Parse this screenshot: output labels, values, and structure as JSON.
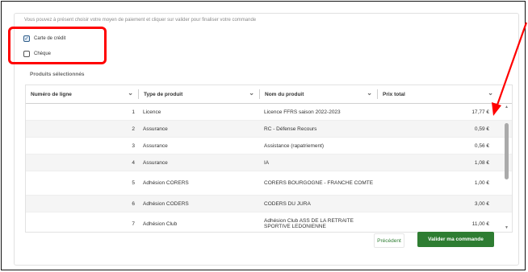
{
  "payment": {
    "instruction": "Vous pouvez à présent choisir votre moyen de paiement et cliquer sur valider pour finaliser votre commande",
    "options": [
      {
        "label": "Carte de crédit",
        "checked": true
      },
      {
        "label": "Chèque",
        "checked": false
      }
    ]
  },
  "products": {
    "title": "Produits sélectionnés",
    "columns": [
      "Numéro de ligne",
      "Type de produit",
      "Nom du produit",
      "Prix total"
    ],
    "rows": [
      {
        "line": "1",
        "type": "Licence",
        "name": "Licence FFRS saison 2022-2023",
        "price": "17,77 €"
      },
      {
        "line": "2",
        "type": "Assurance",
        "name": "RC - Défense Recours",
        "price": "0,59 €"
      },
      {
        "line": "3",
        "type": "Assurance",
        "name": "Assistance (rapatriement)",
        "price": "0,56 €"
      },
      {
        "line": "4",
        "type": "Assurance",
        "name": "IA",
        "price": "1,08 €"
      },
      {
        "line": "5",
        "type": "Adhésion CORERS",
        "name": "CORERS BOURGOGNE - FRANCHE COMTE",
        "price": "1,00 €"
      },
      {
        "line": "6",
        "type": "Adhésion CODERS",
        "name": "CODERS DU JURA",
        "price": "3,00 €"
      },
      {
        "line": "7",
        "type": "Adhésion Club",
        "name": "Adhésion Club ASS DE LA RETRAITE SPORTIVE LEDONIENNE",
        "price": "11,00 €"
      }
    ]
  },
  "actions": {
    "previous": "Précédent",
    "validate": "Valider ma commande"
  },
  "colors": {
    "accent_green": "#2e7d32",
    "annotation_red": "#ff0000",
    "checkbox_blue": "#2e5d8a"
  },
  "icons": [
    "checkbox-checked-icon",
    "checkbox-empty-icon",
    "chevron-down-icon",
    "scroll-up-icon",
    "scroll-down-icon",
    "red-arrow-annotation"
  ]
}
